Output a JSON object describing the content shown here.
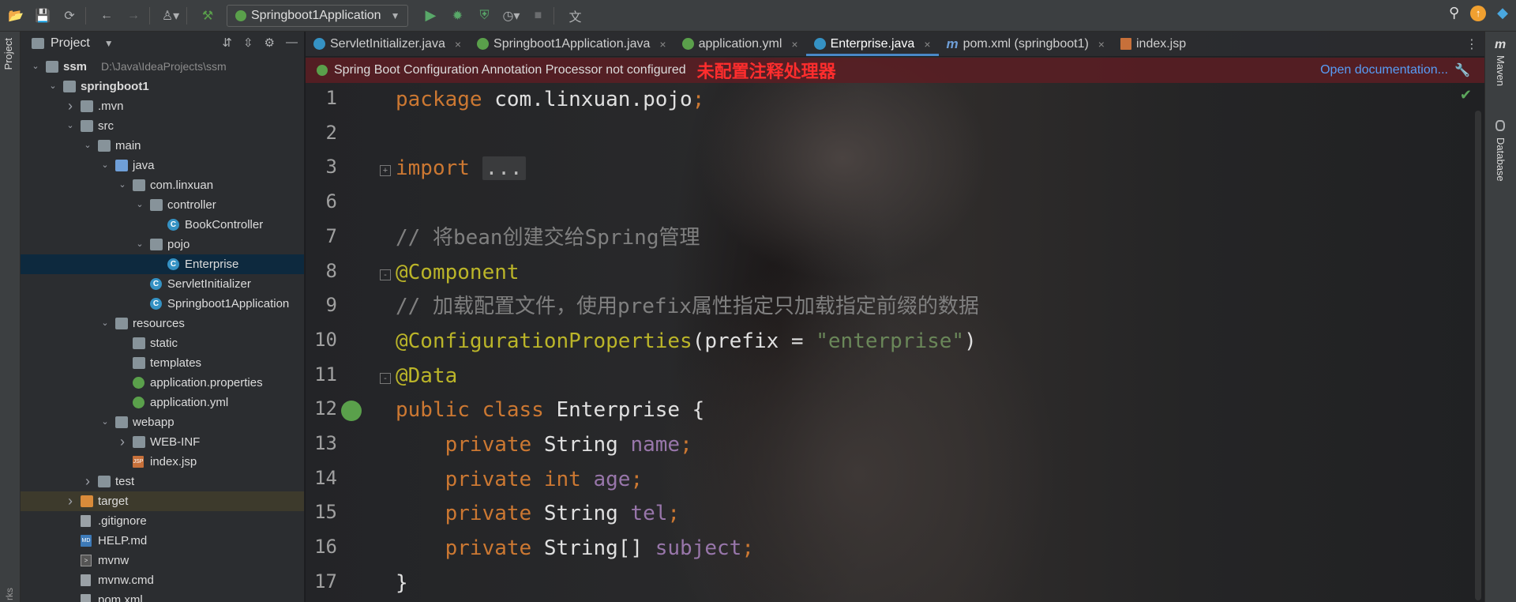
{
  "toolbar": {
    "run_config": "Springboot1Application"
  },
  "left_strip": {
    "project_label": "Project",
    "bottom_label": "rks"
  },
  "project_panel": {
    "title": "Project",
    "tree": [
      {
        "label": "ssm",
        "extra": "D:\\Java\\IdeaProjects\\ssm",
        "icon": "folder",
        "indent": 0,
        "arrow": "down",
        "bold": true
      },
      {
        "label": "springboot1",
        "icon": "folder",
        "indent": 1,
        "arrow": "down",
        "bold": true
      },
      {
        "label": ".mvn",
        "icon": "folder",
        "indent": 2,
        "arrow": "right"
      },
      {
        "label": "src",
        "icon": "folder",
        "indent": 2,
        "arrow": "down"
      },
      {
        "label": "main",
        "icon": "folder",
        "indent": 3,
        "arrow": "down"
      },
      {
        "label": "java",
        "icon": "folder-blue",
        "indent": 4,
        "arrow": "down"
      },
      {
        "label": "com.linxuan",
        "icon": "folder",
        "indent": 5,
        "arrow": "down"
      },
      {
        "label": "controller",
        "icon": "folder",
        "indent": 6,
        "arrow": "down"
      },
      {
        "label": "BookController",
        "icon": "class",
        "indent": 7
      },
      {
        "label": "pojo",
        "icon": "folder",
        "indent": 6,
        "arrow": "down"
      },
      {
        "label": "Enterprise",
        "icon": "class",
        "indent": 7,
        "selected": true
      },
      {
        "label": "ServletInitializer",
        "icon": "class",
        "indent": 6
      },
      {
        "label": "Springboot1Application",
        "icon": "spring-class",
        "indent": 6
      },
      {
        "label": "resources",
        "icon": "folder-res",
        "indent": 4,
        "arrow": "down"
      },
      {
        "label": "static",
        "icon": "folder",
        "indent": 5
      },
      {
        "label": "templates",
        "icon": "folder",
        "indent": 5
      },
      {
        "label": "application.properties",
        "icon": "spring",
        "indent": 5
      },
      {
        "label": "application.yml",
        "icon": "spring",
        "indent": 5
      },
      {
        "label": "webapp",
        "icon": "folder",
        "indent": 4,
        "arrow": "down"
      },
      {
        "label": "WEB-INF",
        "icon": "folder",
        "indent": 5,
        "arrow": "right"
      },
      {
        "label": "index.jsp",
        "icon": "jsp",
        "indent": 5
      },
      {
        "label": "test",
        "icon": "folder",
        "indent": 3,
        "arrow": "right"
      },
      {
        "label": "target",
        "icon": "folder-orange",
        "indent": 2,
        "arrow": "right",
        "target": true
      },
      {
        "label": ".gitignore",
        "icon": "file",
        "indent": 2
      },
      {
        "label": "HELP.md",
        "icon": "md",
        "indent": 2
      },
      {
        "label": "mvnw",
        "icon": "term",
        "indent": 2
      },
      {
        "label": "mvnw.cmd",
        "icon": "file",
        "indent": 2
      },
      {
        "label": "pom.xml",
        "icon": "maven",
        "indent": 2
      }
    ]
  },
  "tabs": [
    {
      "label": "ServletInitializer.java",
      "icon": "class"
    },
    {
      "label": "Springboot1Application.java",
      "icon": "spring"
    },
    {
      "label": "application.yml",
      "icon": "spring"
    },
    {
      "label": "Enterprise.java",
      "icon": "class",
      "active": true
    },
    {
      "label": "pom.xml (springboot1)",
      "icon": "maven"
    },
    {
      "label": "index.jsp",
      "icon": "jsp",
      "no_close": true
    }
  ],
  "banner": {
    "message": "Spring Boot Configuration Annotation Processor not configured",
    "annotation_cn": "未配置注释处理器",
    "link": "Open documentation..."
  },
  "code": {
    "lines": [
      {
        "n": "1",
        "tokens": [
          [
            "kw",
            "package "
          ],
          [
            "pl",
            "com.linxuan.pojo"
          ],
          [
            "kw",
            ";"
          ]
        ]
      },
      {
        "n": "2",
        "tokens": []
      },
      {
        "n": "3",
        "tokens": [
          [
            "kw",
            "import "
          ],
          [
            "fold",
            "..."
          ]
        ],
        "fold": "+"
      },
      {
        "n": "6",
        "tokens": []
      },
      {
        "n": "7",
        "tokens": [
          [
            "cm",
            "// 将bean创建交给Spring管理"
          ]
        ]
      },
      {
        "n": "8",
        "tokens": [
          [
            "an",
            "@Component"
          ]
        ],
        "fold": "-"
      },
      {
        "n": "9",
        "tokens": [
          [
            "cm",
            "// 加载配置文件，使用prefix属性指定只加载指定前缀的数据"
          ]
        ]
      },
      {
        "n": "10",
        "tokens": [
          [
            "an",
            "@ConfigurationProperties"
          ],
          [
            "pl",
            "(prefix = "
          ],
          [
            "st",
            "\"enterprise\""
          ],
          [
            "pl",
            ")"
          ]
        ]
      },
      {
        "n": "11",
        "tokens": [
          [
            "an",
            "@Data"
          ]
        ],
        "fold": "-"
      },
      {
        "n": "12",
        "tokens": [
          [
            "kw",
            "public class "
          ],
          [
            "pl",
            "Enterprise {"
          ]
        ],
        "bean": true
      },
      {
        "n": "13",
        "tokens": [
          [
            "pl",
            "    "
          ],
          [
            "kw",
            "private "
          ],
          [
            "pl",
            "String "
          ],
          [
            "fd",
            "name"
          ],
          [
            "kw",
            ";"
          ]
        ]
      },
      {
        "n": "14",
        "tokens": [
          [
            "pl",
            "    "
          ],
          [
            "kw",
            "private int "
          ],
          [
            "fd",
            "age"
          ],
          [
            "kw",
            ";"
          ]
        ]
      },
      {
        "n": "15",
        "tokens": [
          [
            "pl",
            "    "
          ],
          [
            "kw",
            "private "
          ],
          [
            "pl",
            "String "
          ],
          [
            "fd",
            "tel"
          ],
          [
            "kw",
            ";"
          ]
        ]
      },
      {
        "n": "16",
        "tokens": [
          [
            "pl",
            "    "
          ],
          [
            "kw",
            "private "
          ],
          [
            "pl",
            "String[] "
          ],
          [
            "fd",
            "subject"
          ],
          [
            "kw",
            ";"
          ]
        ]
      },
      {
        "n": "17",
        "tokens": [
          [
            "pl",
            "}"
          ]
        ]
      }
    ]
  },
  "right_strip": {
    "maven_label": "Maven",
    "database_label": "Database"
  }
}
